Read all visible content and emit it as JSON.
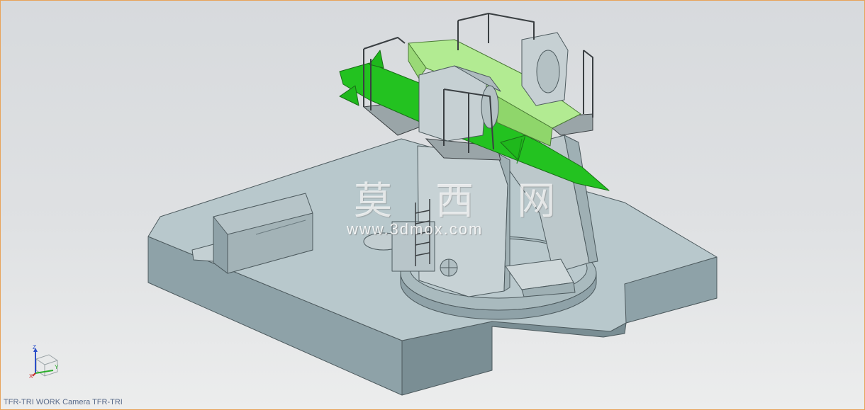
{
  "watermark": {
    "site_name": "莫 西 网",
    "url": "www.3dmox.com"
  },
  "status": {
    "view_label": "TFR-TRI WORK Camera TFR-TRI"
  },
  "triad": {
    "z_label": "Z",
    "y_label": "Y",
    "x_label": "X"
  },
  "colors": {
    "base_top": "#b9c9cd",
    "base_side_left": "#8fa3a9",
    "base_side_front": "#7b8f95",
    "missile": "#22c21f",
    "canister": "#a9e58b",
    "structure": "#c3ced1",
    "railing": "#3a3f42"
  },
  "icons": [
    "coordinate-triad-icon"
  ]
}
